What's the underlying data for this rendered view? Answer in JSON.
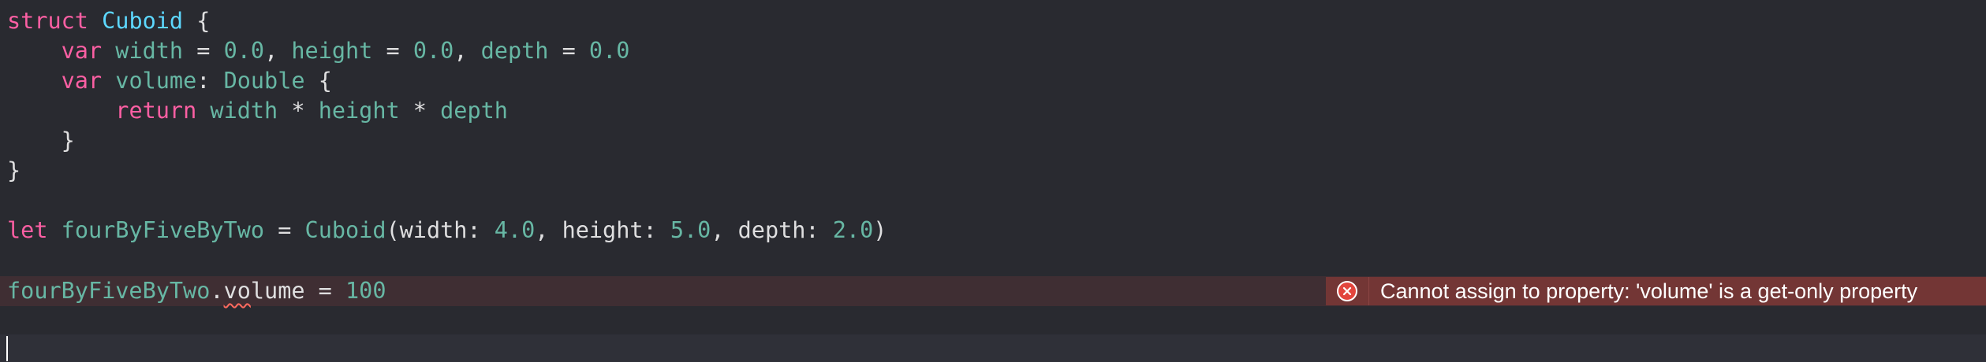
{
  "editor": {
    "code_lines": [
      [
        {
          "t": "struct",
          "c": "kw"
        },
        {
          "t": " ",
          "c": "plain"
        },
        {
          "t": "Cuboid",
          "c": "typedecl"
        },
        {
          "t": " {",
          "c": "plain"
        }
      ],
      [
        {
          "t": "    ",
          "c": "plain"
        },
        {
          "t": "var",
          "c": "kw"
        },
        {
          "t": " ",
          "c": "plain"
        },
        {
          "t": "width",
          "c": "prop"
        },
        {
          "t": " = ",
          "c": "plain"
        },
        {
          "t": "0.0",
          "c": "num"
        },
        {
          "t": ", ",
          "c": "plain"
        },
        {
          "t": "height",
          "c": "prop"
        },
        {
          "t": " = ",
          "c": "plain"
        },
        {
          "t": "0.0",
          "c": "num"
        },
        {
          "t": ", ",
          "c": "plain"
        },
        {
          "t": "depth",
          "c": "prop"
        },
        {
          "t": " = ",
          "c": "plain"
        },
        {
          "t": "0.0",
          "c": "num"
        }
      ],
      [
        {
          "t": "    ",
          "c": "plain"
        },
        {
          "t": "var",
          "c": "kw"
        },
        {
          "t": " ",
          "c": "plain"
        },
        {
          "t": "volume",
          "c": "prop"
        },
        {
          "t": ": ",
          "c": "plain"
        },
        {
          "t": "Double",
          "c": "typeref"
        },
        {
          "t": " {",
          "c": "plain"
        }
      ],
      [
        {
          "t": "        ",
          "c": "plain"
        },
        {
          "t": "return",
          "c": "kw"
        },
        {
          "t": " ",
          "c": "plain"
        },
        {
          "t": "width",
          "c": "prop"
        },
        {
          "t": " * ",
          "c": "plain"
        },
        {
          "t": "height",
          "c": "prop"
        },
        {
          "t": " * ",
          "c": "plain"
        },
        {
          "t": "depth",
          "c": "prop"
        }
      ],
      [
        {
          "t": "    }",
          "c": "plain"
        }
      ],
      [
        {
          "t": "}",
          "c": "plain"
        }
      ],
      [],
      [
        {
          "t": "let",
          "c": "kw"
        },
        {
          "t": " ",
          "c": "plain"
        },
        {
          "t": "fourByFiveByTwo",
          "c": "prop"
        },
        {
          "t": " = ",
          "c": "plain"
        },
        {
          "t": "Cuboid",
          "c": "typeref"
        },
        {
          "t": "(width: ",
          "c": "plain"
        },
        {
          "t": "4.0",
          "c": "num"
        },
        {
          "t": ", height: ",
          "c": "plain"
        },
        {
          "t": "5.0",
          "c": "num"
        },
        {
          "t": ", depth: ",
          "c": "plain"
        },
        {
          "t": "2.0",
          "c": "num"
        },
        {
          "t": ")",
          "c": "plain"
        }
      ],
      [],
      [
        {
          "t": "fourByFiveByTwo",
          "c": "prop"
        },
        {
          "t": ".",
          "c": "plain"
        },
        {
          "t": "vo",
          "c": "plain",
          "err": true
        },
        {
          "t": "lume = ",
          "c": "plain"
        },
        {
          "t": "100",
          "c": "num"
        }
      ]
    ],
    "error_line_index": 9
  },
  "error": {
    "message": "Cannot assign to property: 'volume' is a get-only property",
    "icon": "error-x-circle-icon",
    "colors": {
      "line_background": "#3f2e33",
      "banner_background": "#733635",
      "icon_fill": "#e2453d"
    }
  },
  "theme": {
    "background": "#292a30",
    "keyword": "#fc5fa3",
    "type_declaration": "#5dd8ff",
    "identifier": "#67b7a4",
    "number": "#67b7a4",
    "plain_text": "#dfdfe0"
  }
}
